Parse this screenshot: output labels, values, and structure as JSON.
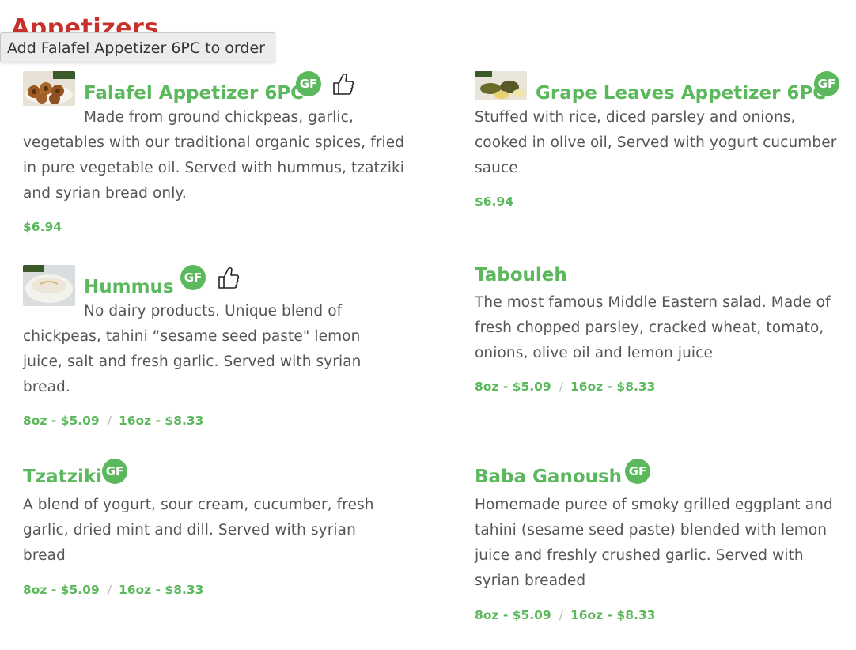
{
  "section_title": "Appetizers",
  "tooltip": "Add Falafel Appetizer 6PC to order",
  "badge_text": "GF",
  "icons": {
    "thumbs_up": "thumbs-up-icon",
    "gf": "gluten-free-badge"
  },
  "colors": {
    "title_red": "#c9302c",
    "accent_green": "#5cb85c",
    "body_text": "#555555"
  },
  "items": {
    "falafel": {
      "name": "Falafel Appetizer 6PC",
      "description": "Made from ground chickpeas, garlic, vegetables with our traditional organic spices, fried in pure vegetable oil. Served with hummus, tzatziki and syrian bread only.",
      "price": "$6.94"
    },
    "grape_leaves": {
      "name": "Grape Leaves Appetizer 6PC",
      "description": "Stuffed with rice, diced parsley and onions, cooked in olive oil, Served with yogurt cucumber sauce",
      "price": "$6.94"
    },
    "hummus": {
      "name": "Hummus",
      "description": "No dairy products. Unique blend of chickpeas, tahini “sesame seed paste\" lemon juice, salt and fresh garlic. Served with syrian bread.",
      "price_small": "8oz - $5.09",
      "price_large": "16oz - $8.33"
    },
    "tabouleh": {
      "name": "Tabouleh",
      "description": "The most famous Middle Eastern salad. Made of fresh chopped parsley, cracked wheat, tomato, onions, olive oil and lemon juice",
      "price_small": "8oz - $5.09",
      "price_large": "16oz - $8.33"
    },
    "tzatziki": {
      "name": "Tzatziki",
      "description": "A blend of yogurt, sour cream, cucumber, fresh garlic, dried mint and dill. Served with syrian bread",
      "price_small": "8oz - $5.09",
      "price_large": "16oz - $8.33"
    },
    "baba_ganoush": {
      "name": "Baba Ganoush",
      "description": "Homemade puree of smoky grilled eggplant and tahini (sesame seed paste) blended with lemon juice and freshly crushed garlic. Served with syrian breaded",
      "price_small": "8oz - $5.09",
      "price_large": "16oz - $8.33"
    }
  }
}
